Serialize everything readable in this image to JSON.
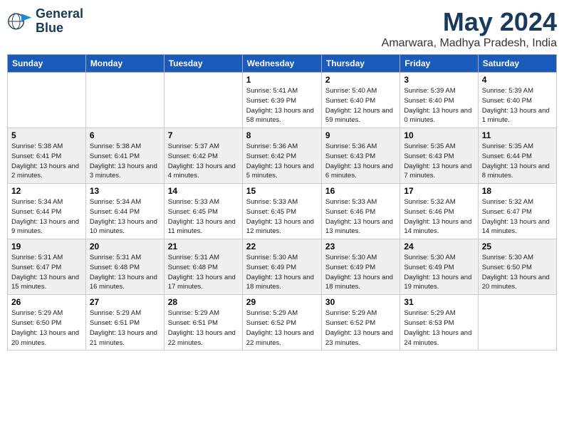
{
  "logo": {
    "line1": "General",
    "line2": "Blue"
  },
  "title": "May 2024",
  "location": "Amarwara, Madhya Pradesh, India",
  "days_of_week": [
    "Sunday",
    "Monday",
    "Tuesday",
    "Wednesday",
    "Thursday",
    "Friday",
    "Saturday"
  ],
  "weeks": [
    [
      {
        "day": "",
        "info": ""
      },
      {
        "day": "",
        "info": ""
      },
      {
        "day": "",
        "info": ""
      },
      {
        "day": "1",
        "info": "Sunrise: 5:41 AM\nSunset: 6:39 PM\nDaylight: 13 hours and 58 minutes."
      },
      {
        "day": "2",
        "info": "Sunrise: 5:40 AM\nSunset: 6:40 PM\nDaylight: 12 hours and 59 minutes."
      },
      {
        "day": "3",
        "info": "Sunrise: 5:39 AM\nSunset: 6:40 PM\nDaylight: 13 hours and 0 minutes."
      },
      {
        "day": "4",
        "info": "Sunrise: 5:39 AM\nSunset: 6:40 PM\nDaylight: 13 hours and 1 minute."
      }
    ],
    [
      {
        "day": "5",
        "info": "Sunrise: 5:38 AM\nSunset: 6:41 PM\nDaylight: 13 hours and 2 minutes."
      },
      {
        "day": "6",
        "info": "Sunrise: 5:38 AM\nSunset: 6:41 PM\nDaylight: 13 hours and 3 minutes."
      },
      {
        "day": "7",
        "info": "Sunrise: 5:37 AM\nSunset: 6:42 PM\nDaylight: 13 hours and 4 minutes."
      },
      {
        "day": "8",
        "info": "Sunrise: 5:36 AM\nSunset: 6:42 PM\nDaylight: 13 hours and 5 minutes."
      },
      {
        "day": "9",
        "info": "Sunrise: 5:36 AM\nSunset: 6:43 PM\nDaylight: 13 hours and 6 minutes."
      },
      {
        "day": "10",
        "info": "Sunrise: 5:35 AM\nSunset: 6:43 PM\nDaylight: 13 hours and 7 minutes."
      },
      {
        "day": "11",
        "info": "Sunrise: 5:35 AM\nSunset: 6:44 PM\nDaylight: 13 hours and 8 minutes."
      }
    ],
    [
      {
        "day": "12",
        "info": "Sunrise: 5:34 AM\nSunset: 6:44 PM\nDaylight: 13 hours and 9 minutes."
      },
      {
        "day": "13",
        "info": "Sunrise: 5:34 AM\nSunset: 6:44 PM\nDaylight: 13 hours and 10 minutes."
      },
      {
        "day": "14",
        "info": "Sunrise: 5:33 AM\nSunset: 6:45 PM\nDaylight: 13 hours and 11 minutes."
      },
      {
        "day": "15",
        "info": "Sunrise: 5:33 AM\nSunset: 6:45 PM\nDaylight: 13 hours and 12 minutes."
      },
      {
        "day": "16",
        "info": "Sunrise: 5:33 AM\nSunset: 6:46 PM\nDaylight: 13 hours and 13 minutes."
      },
      {
        "day": "17",
        "info": "Sunrise: 5:32 AM\nSunset: 6:46 PM\nDaylight: 13 hours and 14 minutes."
      },
      {
        "day": "18",
        "info": "Sunrise: 5:32 AM\nSunset: 6:47 PM\nDaylight: 13 hours and 14 minutes."
      }
    ],
    [
      {
        "day": "19",
        "info": "Sunrise: 5:31 AM\nSunset: 6:47 PM\nDaylight: 13 hours and 15 minutes."
      },
      {
        "day": "20",
        "info": "Sunrise: 5:31 AM\nSunset: 6:48 PM\nDaylight: 13 hours and 16 minutes."
      },
      {
        "day": "21",
        "info": "Sunrise: 5:31 AM\nSunset: 6:48 PM\nDaylight: 13 hours and 17 minutes."
      },
      {
        "day": "22",
        "info": "Sunrise: 5:30 AM\nSunset: 6:49 PM\nDaylight: 13 hours and 18 minutes."
      },
      {
        "day": "23",
        "info": "Sunrise: 5:30 AM\nSunset: 6:49 PM\nDaylight: 13 hours and 18 minutes."
      },
      {
        "day": "24",
        "info": "Sunrise: 5:30 AM\nSunset: 6:49 PM\nDaylight: 13 hours and 19 minutes."
      },
      {
        "day": "25",
        "info": "Sunrise: 5:30 AM\nSunset: 6:50 PM\nDaylight: 13 hours and 20 minutes."
      }
    ],
    [
      {
        "day": "26",
        "info": "Sunrise: 5:29 AM\nSunset: 6:50 PM\nDaylight: 13 hours and 20 minutes."
      },
      {
        "day": "27",
        "info": "Sunrise: 5:29 AM\nSunset: 6:51 PM\nDaylight: 13 hours and 21 minutes."
      },
      {
        "day": "28",
        "info": "Sunrise: 5:29 AM\nSunset: 6:51 PM\nDaylight: 13 hours and 22 minutes."
      },
      {
        "day": "29",
        "info": "Sunrise: 5:29 AM\nSunset: 6:52 PM\nDaylight: 13 hours and 22 minutes."
      },
      {
        "day": "30",
        "info": "Sunrise: 5:29 AM\nSunset: 6:52 PM\nDaylight: 13 hours and 23 minutes."
      },
      {
        "day": "31",
        "info": "Sunrise: 5:29 AM\nSunset: 6:53 PM\nDaylight: 13 hours and 24 minutes."
      },
      {
        "day": "",
        "info": ""
      }
    ]
  ]
}
